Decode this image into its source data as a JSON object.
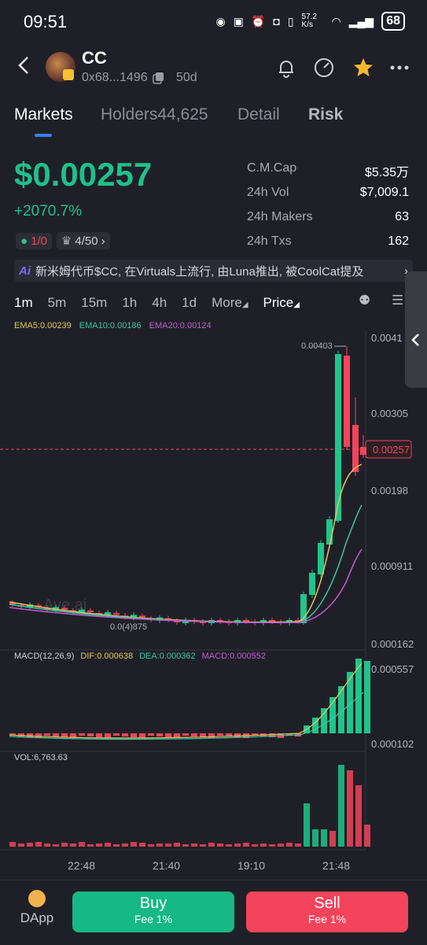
{
  "status_bar": {
    "time": "09:51",
    "net_speed": "57.2 K/s",
    "battery": "68"
  },
  "token": {
    "symbol": "CC",
    "address": "0x68...1496",
    "age": "50d"
  },
  "tabs": [
    {
      "label": "Markets",
      "active": true
    },
    {
      "label": "Holders44,625"
    },
    {
      "label": "Detail"
    },
    {
      "label": "Risk"
    }
  ],
  "price": {
    "value": "$0.00257",
    "change": "+2070.7%"
  },
  "chips": {
    "a": "1/0",
    "b": "4/50"
  },
  "stats": [
    {
      "key": "C.M.Cap",
      "value": "$5.35万"
    },
    {
      "key": "24h Vol",
      "value": "$7,009.1"
    },
    {
      "key": "24h Makers",
      "value": "63"
    },
    {
      "key": "24h Txs",
      "value": "162"
    }
  ],
  "ai_banner": {
    "tag": "Ai",
    "text": "新米姆代币$CC, 在Virtuals上流行, 由Luna推出, 被CoolCat提及"
  },
  "timeframes": [
    "1m",
    "5m",
    "15m",
    "1h",
    "4h",
    "1d",
    "More",
    "Price"
  ],
  "ema": {
    "ema5": "EMA5:0.00239",
    "ema10": "EMA10:0.00186",
    "ema20": "EMA20:0.00124"
  },
  "macd": {
    "title": "MACD(12,26,9)",
    "dif": "DIF:0.000638",
    "dea": "DEA:0.000362",
    "macd": "MACD:0.000552"
  },
  "vol_label": "VOL:6,763.63",
  "chart_data": {
    "type": "candlestick",
    "price_axis": [
      "0.0041",
      "0.00305",
      "0.00198",
      "0.000911",
      "0.000162"
    ],
    "price_ticks": [
      0.0041,
      0.00305,
      0.00198,
      0.000911,
      0.000162
    ],
    "current_price_label": "0.00257",
    "current_price": 0.00257,
    "high_label": "0.00403",
    "high": 0.00403,
    "low_label": "0.0(4)875",
    "low": 8.75e-05,
    "macd_axis": [
      "0.000557",
      "0.000102"
    ],
    "macd_ticks": [
      0.000557,
      0.000102
    ],
    "time_axis": [
      "22:48",
      "21:40",
      "19:10",
      "21:48"
    ],
    "colors": {
      "up": "#1fc58c",
      "down": "#f2445b",
      "ema5": "#e6c45a",
      "ema10": "#3ac6a4",
      "ema20": "#c35ad6"
    }
  },
  "buttons": {
    "dapp": "DApp",
    "buy": "Buy",
    "buy_fee": "Fee 1%",
    "sell": "Sell",
    "sell_fee": "Fee 1%"
  }
}
